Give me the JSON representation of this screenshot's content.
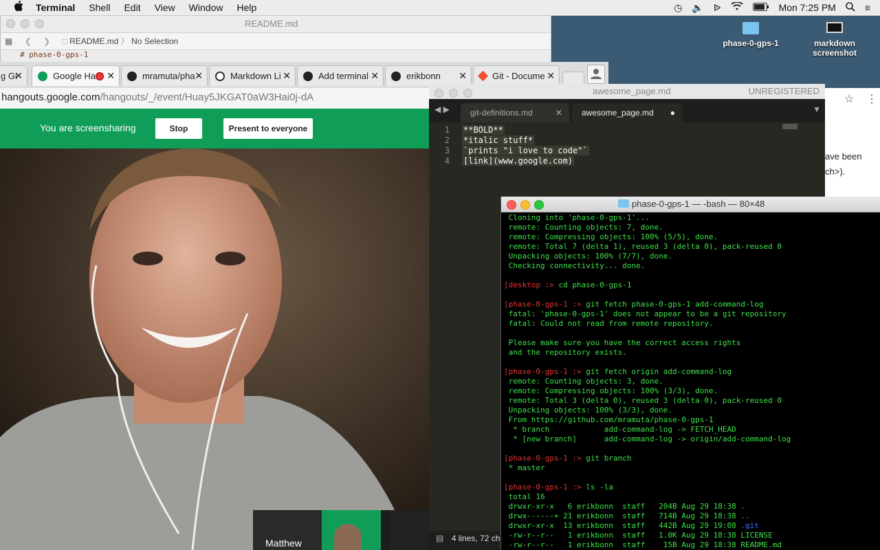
{
  "menubar": {
    "apple_glyph": "",
    "app": "Terminal",
    "items": [
      "Shell",
      "Edit",
      "View",
      "Window",
      "Help"
    ],
    "clock": "Mon 7:25 PM"
  },
  "desktop": {
    "folder_label": "phase-0-gps-1",
    "screenshot_label_1": "markdown",
    "screenshot_label_2": "screenshot"
  },
  "readme": {
    "title": "README.md",
    "path_file": "README.md",
    "path_sel": "No Selection",
    "first_line": "# phase-0-gps-1"
  },
  "chrome": {
    "tabs": [
      {
        "label": "g Gi"
      },
      {
        "label": "Google Ha"
      },
      {
        "label": "mramuta/pha"
      },
      {
        "label": "Markdown Li"
      },
      {
        "label": "Add terminal"
      },
      {
        "label": "erikbonn"
      },
      {
        "label": "Git - Docume"
      }
    ],
    "url_host": "hangouts.google.com",
    "url_path": "/hangouts/_/event/Huay5JKGAT0aW3Hai0j-dA",
    "share_text": "You are screensharing",
    "stop_label": "Stop",
    "present_label": "Present to everyone",
    "thumb_name": "Matthew",
    "right_text_1": "ave been",
    "right_text_2": "ch>)."
  },
  "sublime": {
    "title": "awesome_page.md",
    "unregistered": "UNREGISTERED",
    "tab1": "git-definitions.md",
    "tab2": "awesome_page.md",
    "lines": [
      {
        "n": "1",
        "text": "**BOLD**"
      },
      {
        "n": "2",
        "text": "*italic stuff*"
      },
      {
        "n": "3",
        "text": "`prints \"i love to code\"`"
      },
      {
        "n": "4",
        "text": "[link](www.google.com)"
      }
    ],
    "status": "4 lines, 72 ch"
  },
  "terminal": {
    "title": "phase-0-gps-1 — -bash — 80×48",
    "output": [
      {
        "t": "Cloning into 'phase-0-gps-1'..."
      },
      {
        "t": "remote: Counting objects: 7, done."
      },
      {
        "t": "remote: Compressing objects: 100% (5/5), done."
      },
      {
        "t": "remote: Total 7 (delta 1), reused 3 (delta 0), pack-reused 0"
      },
      {
        "t": "Unpacking objects: 100% (7/7), done."
      },
      {
        "t": "Checking connectivity... done."
      },
      {
        "t": ""
      },
      {
        "p": "[desktop :> ",
        "t": "cd phase-0-gps-1"
      },
      {
        "t": ""
      },
      {
        "p": "[phase-0-gps-1 :> ",
        "t": "git fetch phase-0-gps-1 add-command-log"
      },
      {
        "t": "fatal: 'phase-0-gps-1' does not appear to be a git repository"
      },
      {
        "t": "fatal: Could not read from remote repository."
      },
      {
        "t": ""
      },
      {
        "t": "Please make sure you have the correct access rights"
      },
      {
        "t": "and the repository exists."
      },
      {
        "t": ""
      },
      {
        "p": "[phase-0-gps-1 :> ",
        "t": "git fetch origin add-command-log"
      },
      {
        "t": "remote: Counting objects: 3, done."
      },
      {
        "t": "remote: Compressing objects: 100% (3/3), done."
      },
      {
        "t": "remote: Total 3 (delta 0), reused 3 (delta 0), pack-reused 0"
      },
      {
        "t": "Unpacking objects: 100% (3/3), done."
      },
      {
        "t": "From https://github.com/mramuta/phase-0-gps-1"
      },
      {
        "t": " * branch            add-command-log -> FETCH_HEAD"
      },
      {
        "t": " * [new branch]      add-command-log -> origin/add-command-log"
      },
      {
        "t": ""
      },
      {
        "p": "[phase-0-gps-1 :> ",
        "t": "git branch"
      },
      {
        "t": "* master"
      },
      {
        "t": ""
      },
      {
        "p": "[phase-0-gps-1 :> ",
        "t": "ls -la"
      },
      {
        "t": "total 16"
      },
      {
        "t": "drwxr-xr-x   6 erikbonn  staff   204B Aug 29 18:38 ",
        "d": "."
      },
      {
        "t": "drwx------+ 21 erikbonn  staff   714B Aug 29 18:38 ",
        "d": ".."
      },
      {
        "t": "drwxr-xr-x  13 erikbonn  staff   442B Aug 29 19:08 ",
        "d": ".git"
      },
      {
        "t": "-rw-r--r--   1 erikbonn  staff   1.0K Aug 29 18:38 LICENSE"
      },
      {
        "t": "-rw-r--r--   1 erikbonn  staff    15B Aug 29 18:38 README.md"
      }
    ]
  }
}
